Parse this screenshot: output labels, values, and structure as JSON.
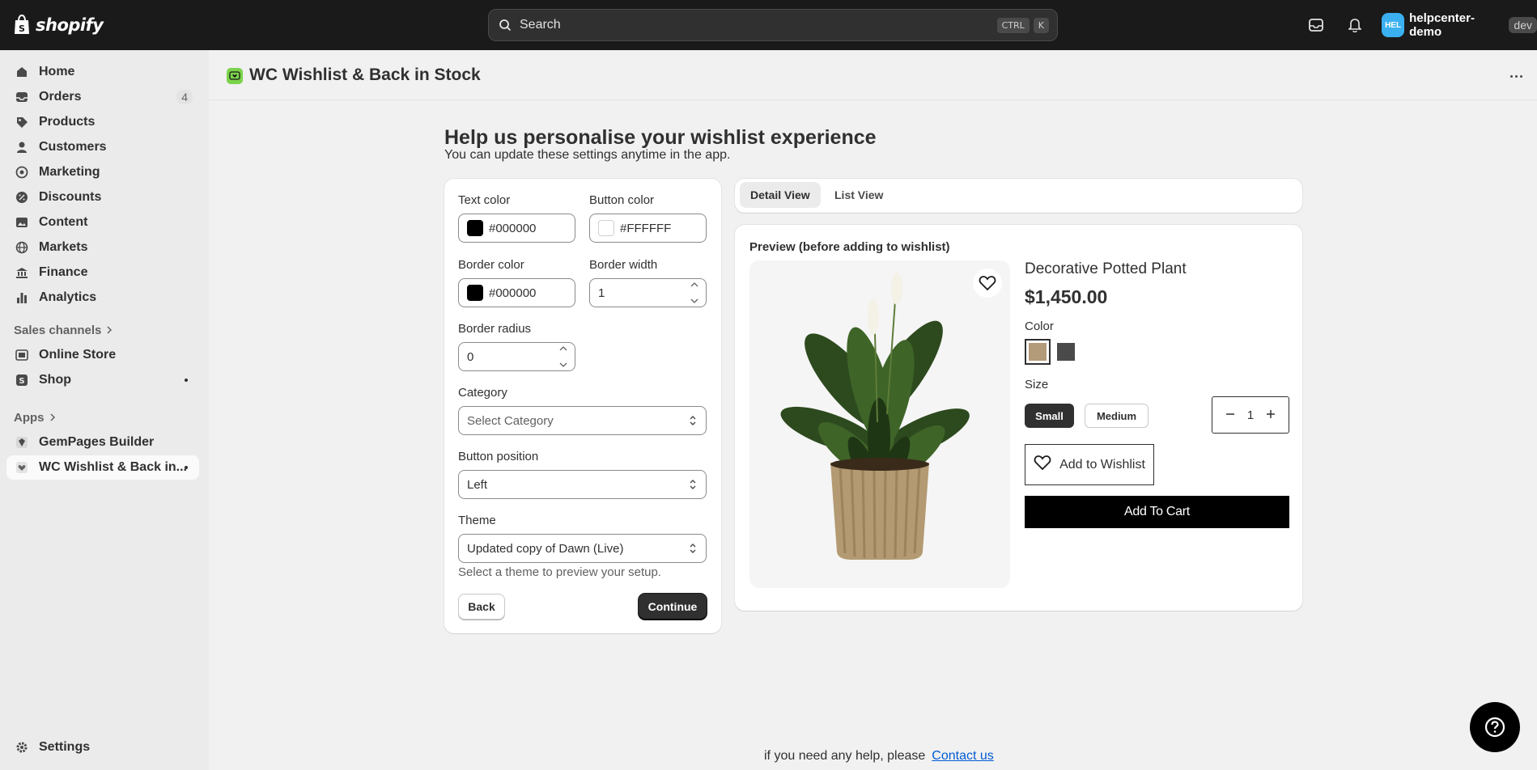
{
  "topbar": {
    "logo_text": "shopify",
    "search_placeholder": "Search",
    "kbd_ctrl": "CTRL",
    "kbd_k": "K",
    "account_initials": "HEL",
    "account_name": "helpcenter-demo",
    "account_badge": "dev"
  },
  "sidebar": {
    "items": [
      {
        "label": "Home",
        "icon": "home-icon"
      },
      {
        "label": "Orders",
        "icon": "inbox-icon",
        "badge": "4"
      },
      {
        "label": "Products",
        "icon": "tag-icon"
      },
      {
        "label": "Customers",
        "icon": "person-icon"
      },
      {
        "label": "Marketing",
        "icon": "target-icon"
      },
      {
        "label": "Discounts",
        "icon": "discount-icon"
      },
      {
        "label": "Content",
        "icon": "image-icon"
      },
      {
        "label": "Markets",
        "icon": "globe-icon"
      },
      {
        "label": "Finance",
        "icon": "bank-icon"
      },
      {
        "label": "Analytics",
        "icon": "bar-chart-icon"
      }
    ],
    "sales_channels_heading": "Sales channels",
    "sales_channels": [
      {
        "label": "Online Store",
        "icon": "store-icon"
      },
      {
        "label": "Shop",
        "icon": "shop-icon"
      }
    ],
    "apps_heading": "Apps",
    "apps": [
      {
        "label": "GemPages Builder",
        "icon": "gem-icon"
      },
      {
        "label": "WC Wishlist & Back in...",
        "icon": "wishlist-app-icon"
      }
    ],
    "settings_label": "Settings"
  },
  "page": {
    "title": "WC Wishlist & Back in Stock",
    "heading": "Help us personalise your wishlist experience",
    "subheading": "You can update these settings anytime in the app."
  },
  "settings_form": {
    "text_color_label": "Text color",
    "text_color_value": "#000000",
    "button_color_label": "Button color",
    "button_color_value": "#FFFFFF",
    "border_color_label": "Border color",
    "border_color_value": "#000000",
    "border_width_label": "Border width",
    "border_width_value": "1",
    "border_radius_label": "Border radius",
    "border_radius_value": "0",
    "category_label": "Category",
    "category_value": "Select Category",
    "button_position_label": "Button position",
    "button_position_value": "Left",
    "theme_label": "Theme",
    "theme_value": "Updated copy of Dawn (Live)",
    "theme_hint": "Select a theme to preview your setup.",
    "back_label": "Back",
    "continue_label": "Continue"
  },
  "preview_tabs": {
    "detail_view": "Detail View",
    "list_view": "List View"
  },
  "preview": {
    "title": "Preview (before adding to wishlist)",
    "product_title": "Decorative Potted Plant",
    "price": "$1,450.00",
    "color_label": "Color",
    "color_swatches": [
      "#b39a78",
      "#4a4a4a"
    ],
    "size_label": "Size",
    "sizes": [
      "Small",
      "Medium"
    ],
    "quantity": "1",
    "add_to_wishlist": "Add to Wishlist",
    "add_to_cart": "Add To Cart"
  },
  "footer": {
    "help_text": "if you need any help, please",
    "contact_link": "Contact us"
  }
}
